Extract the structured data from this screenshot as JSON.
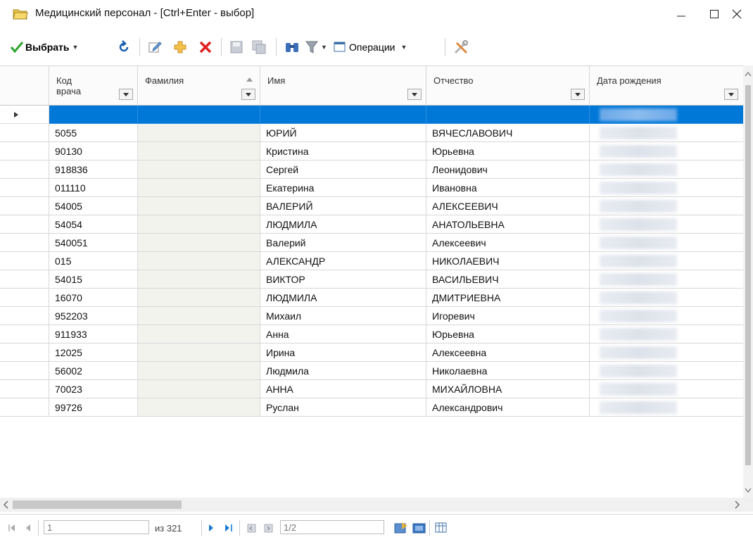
{
  "window": {
    "title": "Медицинский персонал - [Ctrl+Enter - выбор]"
  },
  "toolbar": {
    "select_label": "Выбрать",
    "operations_label": "Операции"
  },
  "grid": {
    "columns": [
      "Код врача",
      "Фамилия",
      "Имя",
      "Отчество",
      "Дата рождения"
    ],
    "rows": [
      {
        "code": "",
        "name": "",
        "patronymic": ""
      },
      {
        "code": "5055",
        "name": "ЮРИЙ",
        "patronymic": "ВЯЧЕСЛАВОВИЧ"
      },
      {
        "code": "90130",
        "name": "Кристина",
        "patronymic": "Юрьевна"
      },
      {
        "code": "918836",
        "name": "Сергей",
        "patronymic": "Леонидович"
      },
      {
        "code": "011110",
        "name": "Екатерина",
        "patronymic": "Ивановна"
      },
      {
        "code": "54005",
        "name": "ВАЛЕРИЙ",
        "patronymic": "АЛЕКСЕЕВИЧ"
      },
      {
        "code": "54054",
        "name": "ЛЮДМИЛА",
        "patronymic": "АНАТОЛЬЕВНА"
      },
      {
        "code": "540051",
        "name": "Валерий",
        "patronymic": "Алексеевич"
      },
      {
        "code": "015",
        "name": "АЛЕКСАНДР",
        "patronymic": "НИКОЛАЕВИЧ"
      },
      {
        "code": "54015",
        "name": "ВИКТОР",
        "patronymic": "ВАСИЛЬЕВИЧ"
      },
      {
        "code": "16070",
        "name": "ЛЮДМИЛА",
        "patronymic": "ДМИТРИЕВНА"
      },
      {
        "code": "952203",
        "name": "Михаил",
        "patronymic": "Игоревич"
      },
      {
        "code": "911933",
        "name": "Анна",
        "patronymic": "Юрьевна"
      },
      {
        "code": "12025",
        "name": "Ирина",
        "patronymic": "Алексеевна"
      },
      {
        "code": "56002",
        "name": "Людмила",
        "patronymic": "Николаевна"
      },
      {
        "code": "70023",
        "name": "АННА",
        "patronymic": "МИХАЙЛОВНА"
      },
      {
        "code": "99726",
        "name": "Руслан",
        "patronymic": "Александрович"
      }
    ]
  },
  "navigator": {
    "current_record": "1",
    "total_label": "из 321",
    "page_value": "1/2"
  },
  "colors": {
    "selection": "#0078d7",
    "accent_green": "#2ea52e",
    "delete_red": "#e02020"
  }
}
